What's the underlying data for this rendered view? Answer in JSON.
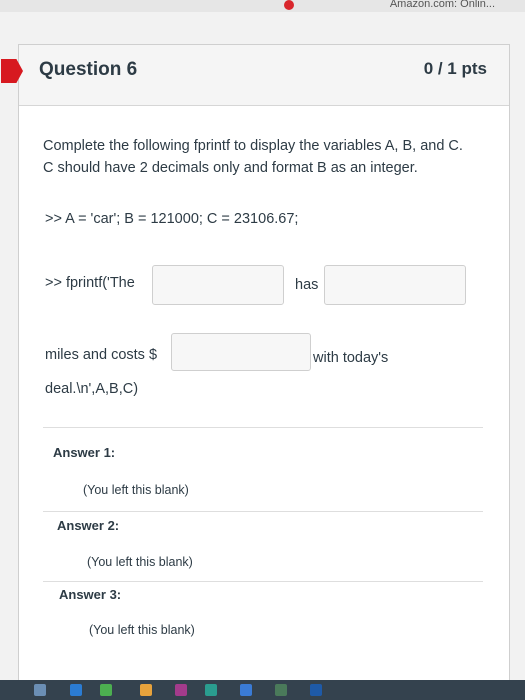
{
  "browser": {
    "bookmark_left": "",
    "bookmark_right": "Amazon.com: Onlin..."
  },
  "question": {
    "title": "Question 6",
    "points": "0 / 1 pts",
    "prompt": "Complete the following fprintf to display the variables A, B, and C. C should have 2 decimals only and format B as an integer.",
    "code": ">> A = 'car'; B = 121000; C = 23106.67;",
    "line1_prefix": ">> fprintf('The",
    "line1_middle": "has",
    "line2_prefix": "miles and costs $",
    "line2_suffix": "with today's",
    "line3": "deal.\\n',A,B,C)"
  },
  "answers": [
    {
      "label": "Answer 1:",
      "value": "(You left this blank)"
    },
    {
      "label": "Answer 2:",
      "value": "(You left this blank)"
    },
    {
      "label": "Answer 3:",
      "value": "(You left this blank)"
    }
  ],
  "colors": {
    "flag": "#d71920",
    "text": "#2d3b45"
  }
}
